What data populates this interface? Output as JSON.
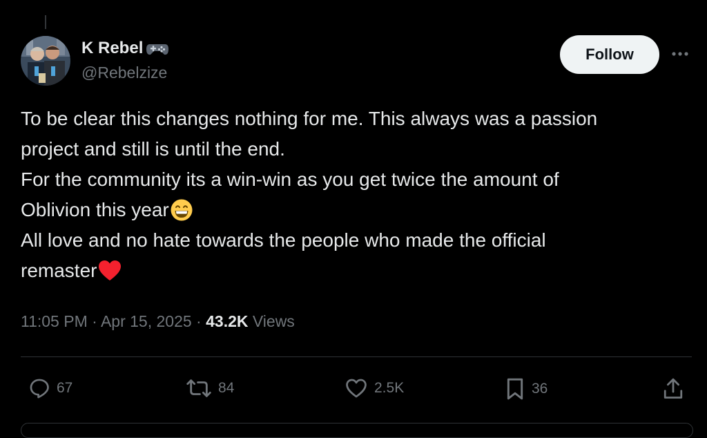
{
  "author": {
    "display_name": "K Rebel",
    "badge_icon": "gamepad-icon",
    "handle": "@Rebelzize",
    "avatar_icon": "profile-photo"
  },
  "header": {
    "follow_label": "Follow",
    "more_icon": "more-options-icon"
  },
  "tweet": {
    "lines": [
      "To be clear this changes nothing for me. This always was a passion",
      "project and still is until the end.",
      "For the community its a win-win as you get twice the amount of",
      "Oblivion this year",
      "All love and no hate towards the people who made the official",
      "remaster"
    ],
    "emoji_grin": "grinning-face-emoji",
    "emoji_heart": "red-heart-emoji"
  },
  "meta": {
    "time": "11:05 PM",
    "separator": "·",
    "date": "Apr 15, 2025",
    "views_count": "43.2K",
    "views_label": "Views"
  },
  "actions": {
    "replies": "67",
    "reposts": "84",
    "likes": "2.5K",
    "bookmarks": "36"
  },
  "colors": {
    "background": "#000000",
    "text_primary": "#e7e9ea",
    "text_secondary": "#71767b",
    "follow_bg": "#eff3f4",
    "heart": "#f4212e",
    "divider": "#2f3336"
  }
}
